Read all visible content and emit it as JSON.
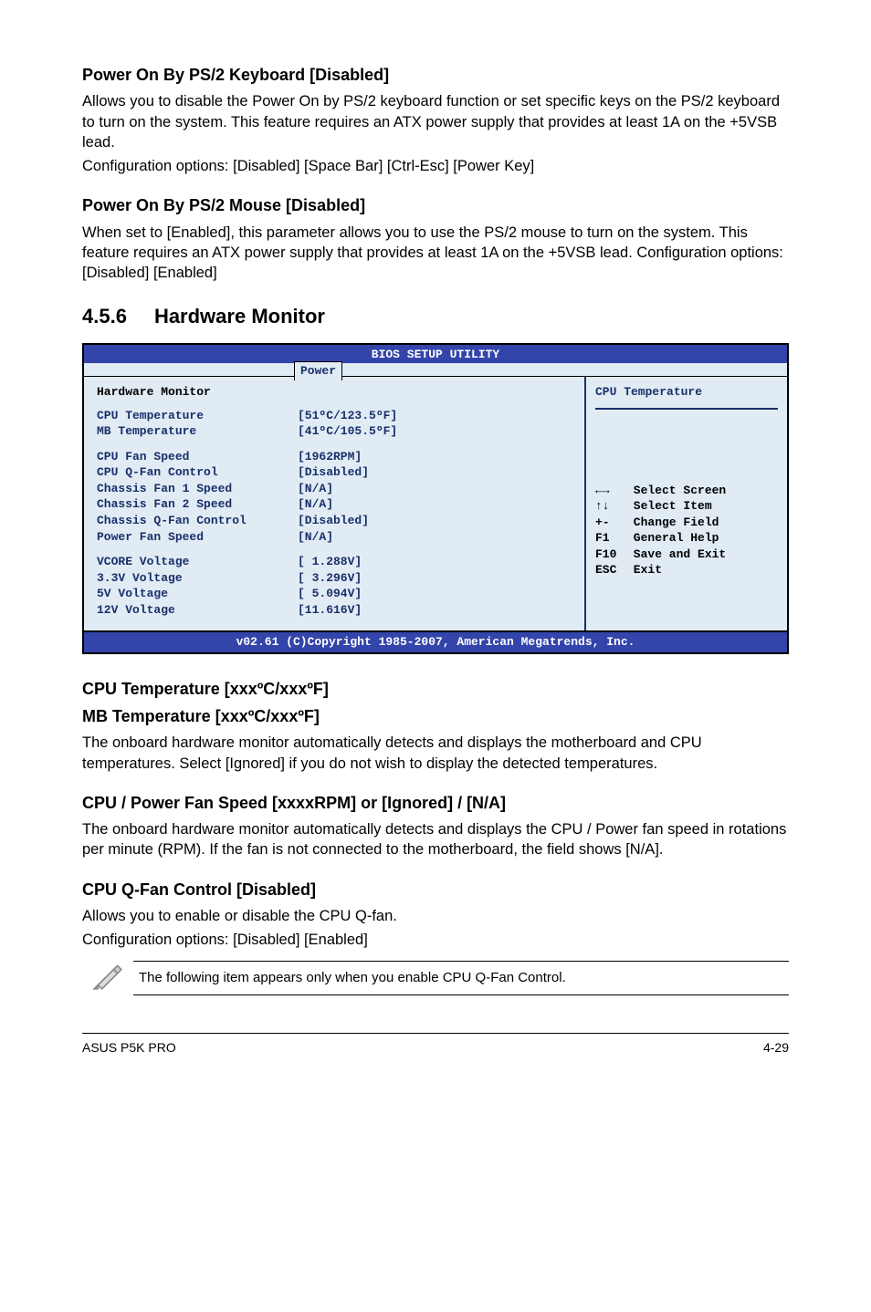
{
  "s1": {
    "title": "Power On By PS/2 Keyboard [Disabled]",
    "p1": "Allows you to disable the Power On by PS/2 keyboard function or set specific keys on the PS/2 keyboard to turn on the system. This feature requires an ATX power supply that provides at least 1A on the +5VSB lead.",
    "p2": "Configuration options: [Disabled] [Space Bar] [Ctrl-Esc] [Power Key]"
  },
  "s2": {
    "title": "Power On By PS/2 Mouse [Disabled]",
    "p1": "When set to [Enabled], this parameter allows you to use the PS/2 mouse to turn on the system. This feature requires an ATX power supply that provides at least 1A on the +5VSB lead. Configuration options: [Disabled] [Enabled]"
  },
  "sec": {
    "num": "4.5.6",
    "title": "Hardware Monitor"
  },
  "bios": {
    "title": "BIOS SETUP UTILITY",
    "tab": "Power",
    "hm": "Hardware Monitor",
    "help": "CPU Temperature",
    "rows1": [
      {
        "l": "CPU Temperature",
        "v": "[51ºC/123.5ºF]"
      },
      {
        "l": "MB Temperature",
        "v": "[41ºC/105.5ºF]"
      }
    ],
    "rows2": [
      {
        "l": "CPU Fan Speed",
        "v": "[1962RPM]"
      },
      {
        "l": "CPU Q-Fan Control",
        "v": "[Disabled]"
      },
      {
        "l": "Chassis Fan 1 Speed",
        "v": "[N/A]"
      },
      {
        "l": "Chassis Fan 2 Speed",
        "v": "[N/A]"
      },
      {
        "l": "Chassis Q-Fan Control",
        "v": "[Disabled]"
      },
      {
        "l": "Power Fan Speed",
        "v": "[N/A]"
      }
    ],
    "rows3": [
      {
        "l": "VCORE Voltage",
        "v": "[ 1.288V]"
      },
      {
        "l": "3.3V  Voltage",
        "v": "[ 3.296V]"
      },
      {
        "l": "5V    Voltage",
        "v": "[ 5.094V]"
      },
      {
        "l": "12V   Voltage",
        "v": "[11.616V]"
      }
    ],
    "keys": [
      {
        "k": "←→",
        "t": "Select Screen"
      },
      {
        "k": "↑↓",
        "t": "Select Item"
      },
      {
        "k": "+-",
        "t": "Change Field"
      },
      {
        "k": "F1",
        "t": "General Help"
      },
      {
        "k": "F10",
        "t": "Save and Exit"
      },
      {
        "k": "ESC",
        "t": "Exit"
      }
    ],
    "footer": "v02.61 (C)Copyright 1985-2007, American Megatrends, Inc."
  },
  "s3": {
    "t1": "CPU Temperature [xxxºC/xxxºF]",
    "t2": "MB Temperature [xxxºC/xxxºF]",
    "p": "The onboard hardware monitor automatically detects and displays the motherboard and CPU temperatures. Select [Ignored] if you do not wish to display the detected temperatures."
  },
  "s4": {
    "t": "CPU / Power Fan Speed [xxxxRPM] or [Ignored] / [N/A]",
    "p": "The onboard hardware monitor automatically detects and displays the CPU / Power fan speed in rotations per minute (RPM). If the fan is not connected to the motherboard, the field shows [N/A]."
  },
  "s5": {
    "t": "CPU Q-Fan Control [Disabled]",
    "p1": "Allows you to enable or disable the CPU Q-fan.",
    "p2": "Configuration options: [Disabled] [Enabled]"
  },
  "note": "The following item appears only when you enable CPU Q-Fan Control.",
  "foot": {
    "l": "ASUS P5K PRO",
    "r": "4-29"
  }
}
